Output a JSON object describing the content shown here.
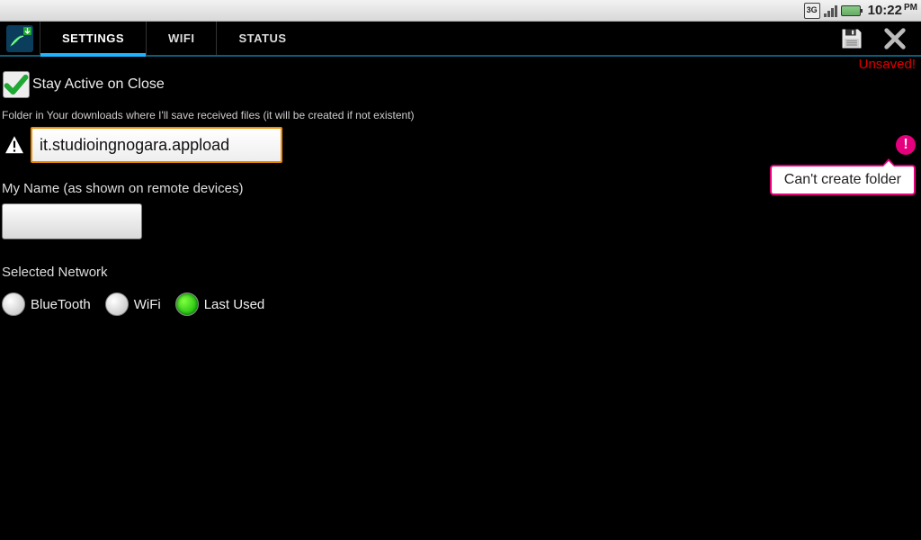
{
  "statusbar": {
    "time": "10:22",
    "ampm": "PM",
    "net": "3G"
  },
  "tabs": {
    "settings": "SETTINGS",
    "wifi": "WIFI",
    "status": "STATUS",
    "active": "settings"
  },
  "banner": {
    "unsaved": "Unsaved!"
  },
  "stay_active": {
    "label": "Stay Active on Close",
    "checked": true
  },
  "folder": {
    "hint": "Folder in Your downloads where I'll save received files (it will be created if not existent)",
    "value": "it.studioingnogara.appload",
    "error_tooltip": "Can't create folder"
  },
  "myname": {
    "label": "My Name (as shown on remote devices)",
    "value": ""
  },
  "network": {
    "label": "Selected Network",
    "options": {
      "bluetooth": "BlueTooth",
      "wifi": "WiFi",
      "last": "Last Used"
    },
    "selected": "last"
  }
}
